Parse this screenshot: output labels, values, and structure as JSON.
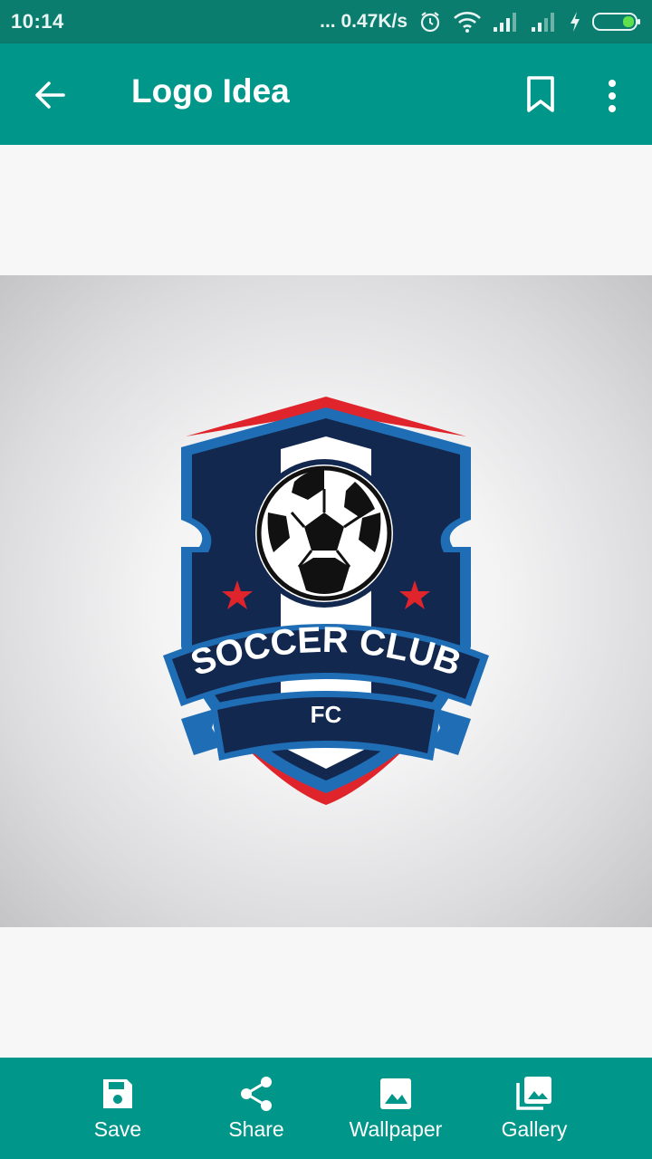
{
  "status_bar": {
    "time": "10:14",
    "network_speed": "... 0.47K/s",
    "icons": [
      "alarm-icon",
      "wifi-icon",
      "signal-icon",
      "signal-icon",
      "charging-icon",
      "battery-icon"
    ]
  },
  "app_bar": {
    "title": "Logo Idea",
    "icons": [
      "back-arrow-icon",
      "bookmark-icon",
      "more-vert-icon"
    ]
  },
  "logo": {
    "title": "SOCCER CLUB",
    "subtitle": "FC"
  },
  "bottom_actions": [
    {
      "label": "Save",
      "icon": "save-icon"
    },
    {
      "label": "Share",
      "icon": "share-icon"
    },
    {
      "label": "Wallpaper",
      "icon": "wallpaper-icon"
    },
    {
      "label": "Gallery",
      "icon": "gallery-icon"
    }
  ],
  "colors": {
    "status_bar": "#0b7d6f",
    "app_bar": "#00978a",
    "badge_navy": "#13284f",
    "badge_blue": "#1f6eb5",
    "badge_red": "#e0242c"
  }
}
